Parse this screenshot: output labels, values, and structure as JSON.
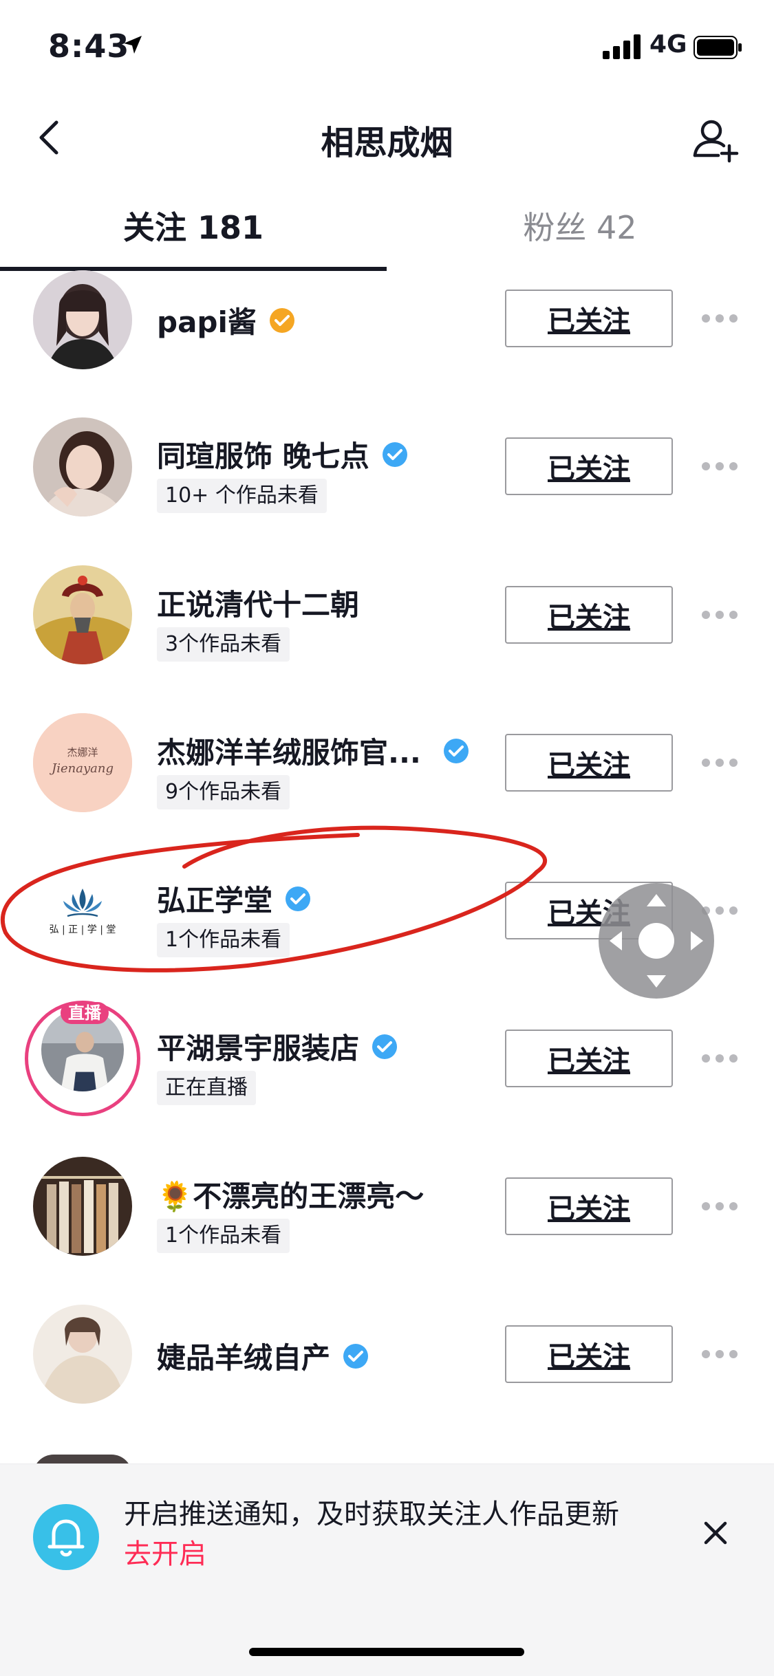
{
  "status_bar": {
    "time": "8:43",
    "network": "4G"
  },
  "nav": {
    "title": "相思成烟"
  },
  "tabs": [
    {
      "label": "关注 181",
      "active": true
    },
    {
      "label": "粉丝 42",
      "active": false
    }
  ],
  "follow_button_label": "已关注",
  "rows": [
    {
      "name": "papi酱",
      "verified": "gold",
      "badge": "",
      "live": false
    },
    {
      "name": "同瑄服饰 晚七点",
      "verified": "blue",
      "badge": "10+ 个作品未看",
      "live": false
    },
    {
      "name": "正说清代十二朝",
      "verified": "",
      "badge": "3个作品未看",
      "live": false
    },
    {
      "name": "杰娜洋羊绒服饰官...",
      "verified": "blue",
      "badge": "9个作品未看",
      "live": false,
      "avatar_logo": [
        "杰娜洋",
        "Jienayang"
      ]
    },
    {
      "name": "弘正学堂",
      "verified": "blue",
      "badge": "1个作品未看",
      "live": false,
      "avatar_logo": [
        "弘 | 正 | 学 | 堂"
      ]
    },
    {
      "name": "平湖景宇服装店",
      "verified": "blue",
      "badge": "正在直播",
      "live": true,
      "live_tag": "直播"
    },
    {
      "name": "🌻不漂亮的王漂亮～",
      "verified": "",
      "badge": "1个作品未看",
      "live": false
    },
    {
      "name": "婕品羊绒自产",
      "verified": "blue",
      "badge": "",
      "live": false
    }
  ],
  "push_banner": {
    "text": "开启推送通知，及时获取关注人作品更新",
    "link": "去开启"
  },
  "colors": {
    "accent_pink": "#fe2c55",
    "verify_blue": "#3da8f5",
    "verify_gold": "#f5a623",
    "live_pink": "#e9407f",
    "annotation_red": "#d9251d"
  }
}
